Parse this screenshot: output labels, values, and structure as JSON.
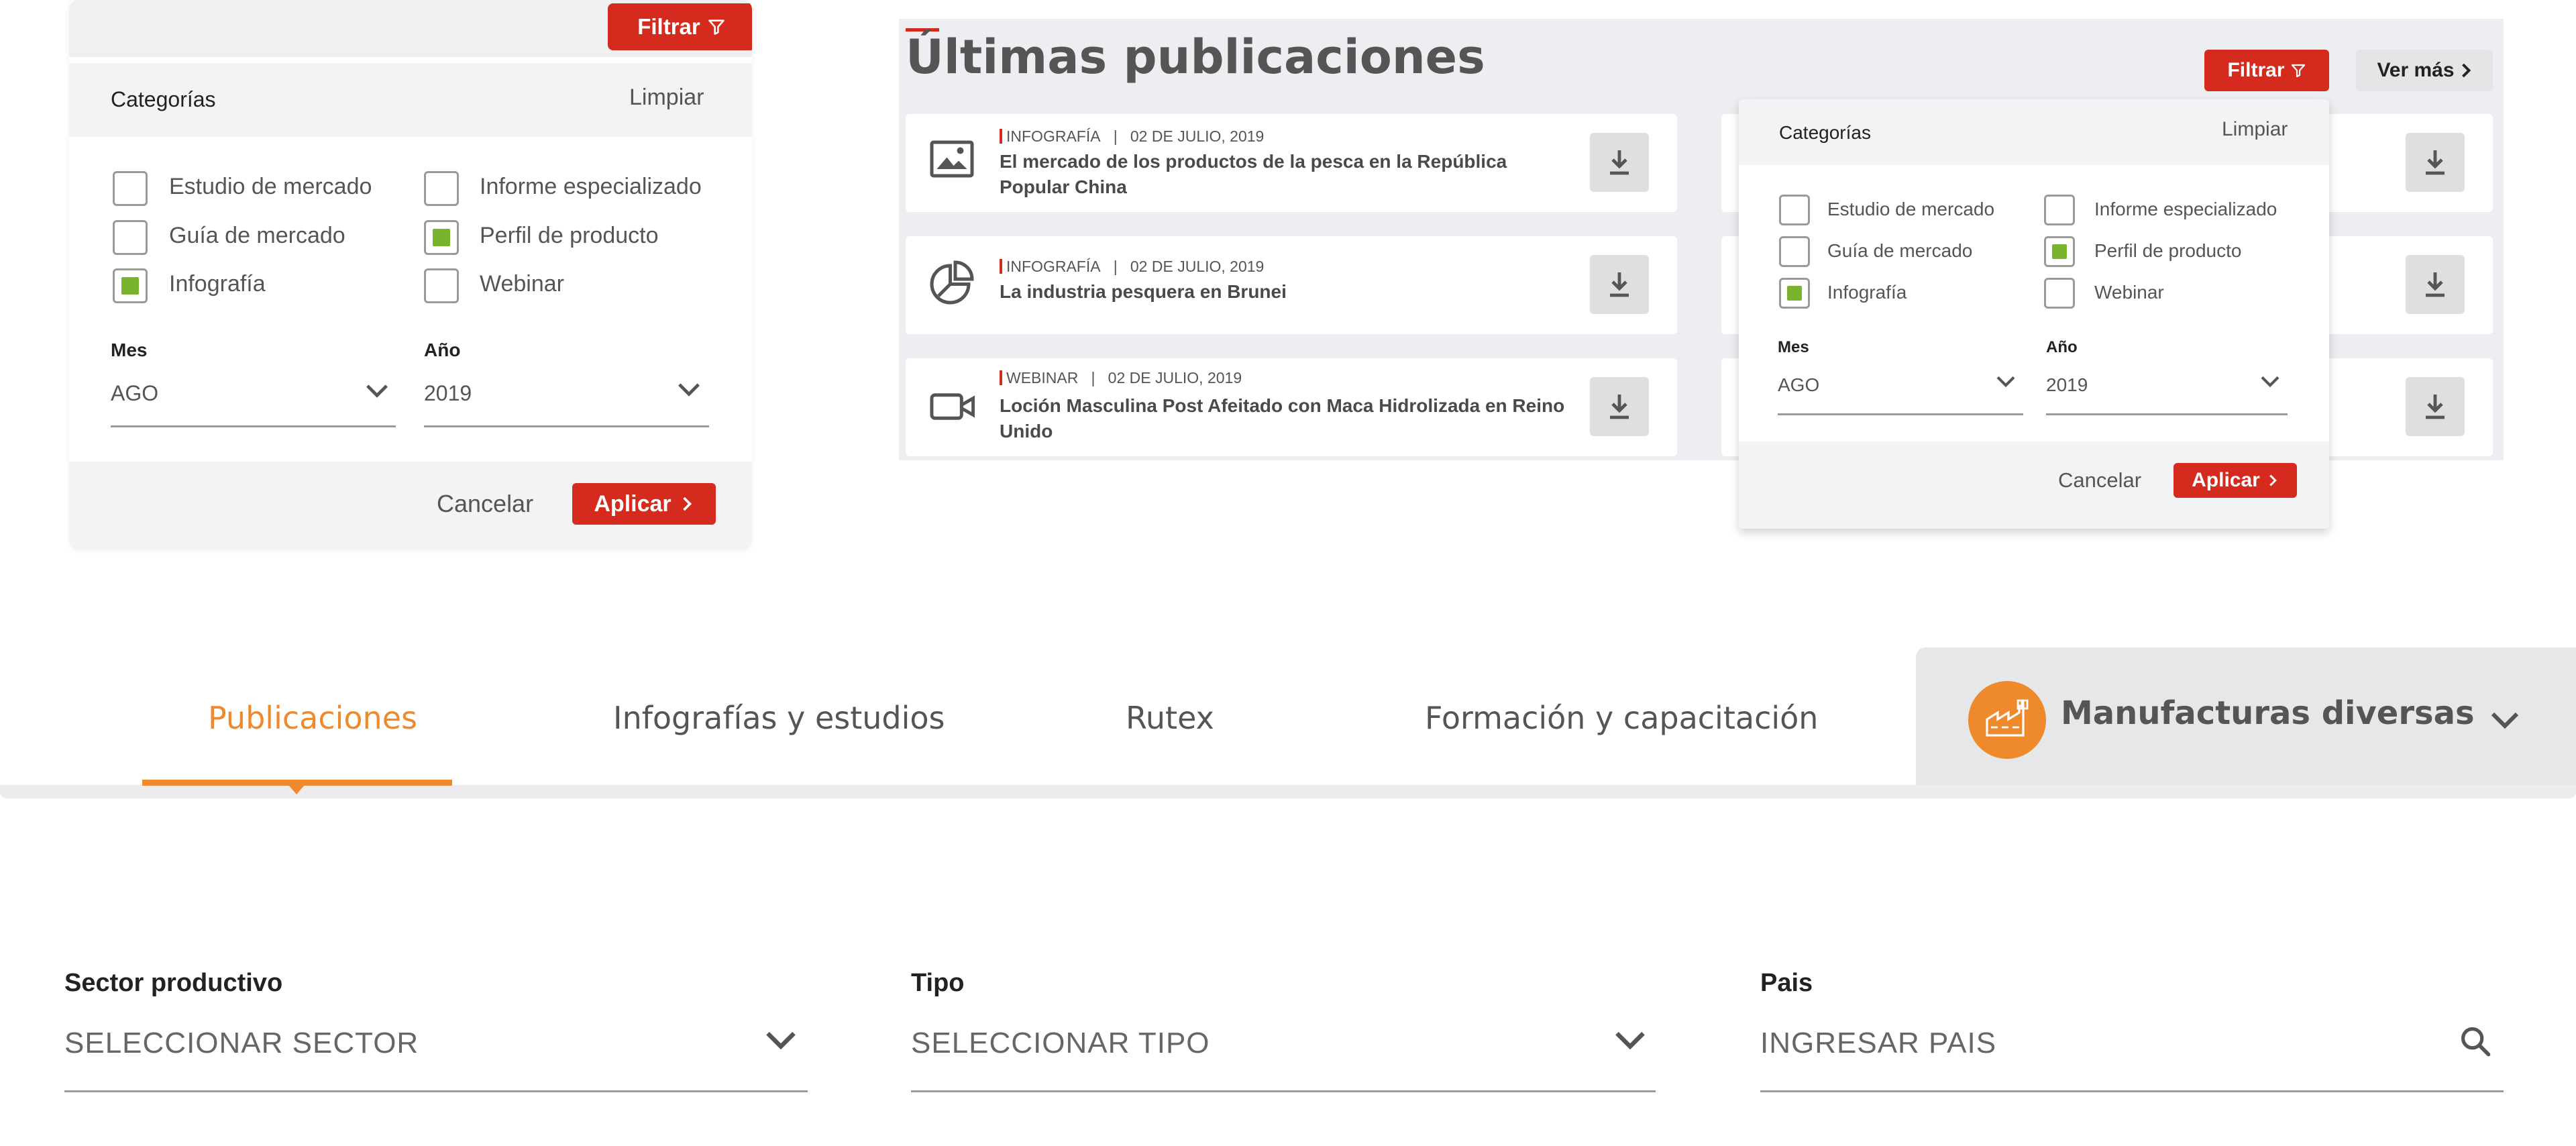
{
  "panel1": {
    "filter_button": "Filtrar",
    "categories_label": "Categorías",
    "clear_label": "Limpiar",
    "checkboxes": [
      {
        "label": "Estudio de mercado",
        "checked": false
      },
      {
        "label": "Informe especializado",
        "checked": false
      },
      {
        "label": "Guía de mercado",
        "checked": false
      },
      {
        "label": "Perfil de producto",
        "checked": true
      },
      {
        "label": "Infografía",
        "checked": true
      },
      {
        "label": "Webinar",
        "checked": false
      }
    ],
    "month_label": "Mes",
    "month_value": "AGO",
    "year_label": "Año",
    "year_value": "2019",
    "cancel": "Cancelar",
    "apply": "Aplicar"
  },
  "publications": {
    "title": "Últimas publicaciones",
    "filter_button": "Filtrar",
    "more_button": "Ver más",
    "items": [
      {
        "type": "INFOGRAFÍA",
        "date": "02 DE JULIO, 2019",
        "title_line1": "El mercado de los productos de la pesca en la República",
        "title_line2": "Popular China",
        "icon": "image-icon"
      },
      {
        "type": "INFOGRAFÍA",
        "date": "02 DE JULIO, 2019",
        "title_line1": "La industria pesquera en Brunei",
        "title_line2": "",
        "icon": "pie-chart-icon"
      },
      {
        "type": "WEBINAR",
        "date": "02 DE JULIO, 2019",
        "title_line1": "Loción Masculina Post Afeitado con Maca Hidrolizada en Reino",
        "title_line2": "Unido",
        "icon": "video-camera-icon"
      }
    ]
  },
  "panel2": {
    "categories_label": "Categorías",
    "clear_label": "Limpiar",
    "checkboxes": [
      {
        "label": "Estudio de mercado",
        "checked": false
      },
      {
        "label": "Informe especializado",
        "checked": false
      },
      {
        "label": "Guía de mercado",
        "checked": false
      },
      {
        "label": "Perfil de producto",
        "checked": true
      },
      {
        "label": "Infografía",
        "checked": true
      },
      {
        "label": "Webinar",
        "checked": false
      }
    ],
    "month_label": "Mes",
    "month_value": "AGO",
    "year_label": "Año",
    "year_value": "2019",
    "cancel": "Cancelar",
    "apply": "Aplicar"
  },
  "tabs": {
    "items": [
      "Publicaciones",
      "Infografías y estudios",
      "Rutex",
      "Formación y capacitación"
    ],
    "active_index": 0,
    "sector": {
      "label": "Manufacturas diversas",
      "icon": "factory-icon"
    }
  },
  "filters": {
    "sector": {
      "label": "Sector productivo",
      "value": "SELECCIONAR SECTOR"
    },
    "type": {
      "label": "Tipo",
      "value": "SELECCIONAR TIPO"
    },
    "country": {
      "label": "Pais",
      "placeholder": "INGRESAR PAIS"
    }
  },
  "colors": {
    "brand_red": "#d52b1e",
    "accent_orange": "#ef8a2c",
    "check_green": "#7ab32e"
  }
}
